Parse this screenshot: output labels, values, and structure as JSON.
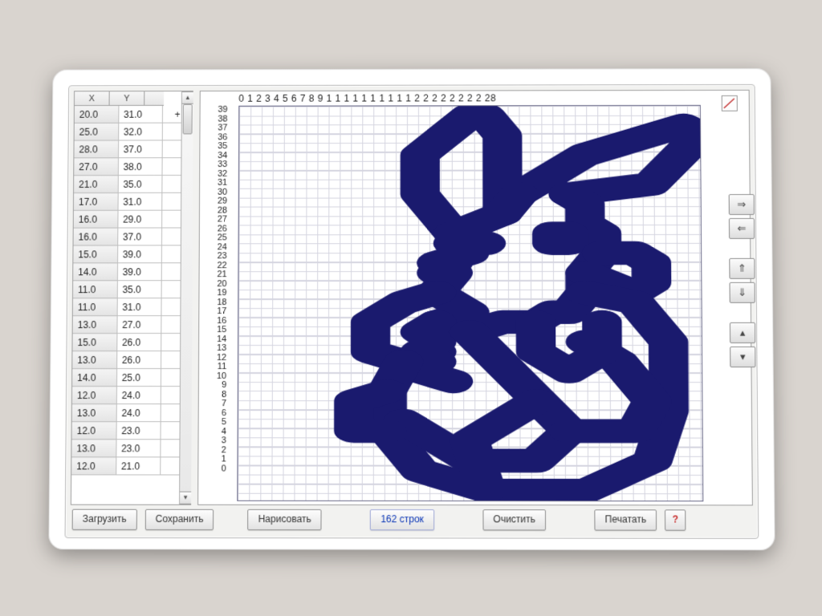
{
  "table": {
    "headers": {
      "x": "X",
      "y": "Y"
    },
    "rows": [
      {
        "x": "20.0",
        "y": "31.0",
        "m": "+"
      },
      {
        "x": "25.0",
        "y": "32.0",
        "m": ""
      },
      {
        "x": "28.0",
        "y": "37.0",
        "m": ""
      },
      {
        "x": "27.0",
        "y": "38.0",
        "m": ""
      },
      {
        "x": "21.0",
        "y": "35.0",
        "m": ""
      },
      {
        "x": "17.0",
        "y": "31.0",
        "m": ""
      },
      {
        "x": "16.0",
        "y": "29.0",
        "m": ""
      },
      {
        "x": "16.0",
        "y": "37.0",
        "m": ""
      },
      {
        "x": "15.0",
        "y": "39.0",
        "m": ""
      },
      {
        "x": "14.0",
        "y": "39.0",
        "m": ""
      },
      {
        "x": "11.0",
        "y": "35.0",
        "m": ""
      },
      {
        "x": "11.0",
        "y": "31.0",
        "m": ""
      },
      {
        "x": "13.0",
        "y": "27.0",
        "m": ""
      },
      {
        "x": "15.0",
        "y": "26.0",
        "m": ""
      },
      {
        "x": "13.0",
        "y": "26.0",
        "m": ""
      },
      {
        "x": "14.0",
        "y": "25.0",
        "m": ""
      },
      {
        "x": "12.0",
        "y": "24.0",
        "m": ""
      },
      {
        "x": "13.0",
        "y": "24.0",
        "m": ""
      },
      {
        "x": "12.0",
        "y": "23.0",
        "m": ""
      },
      {
        "x": "13.0",
        "y": "23.0",
        "m": ""
      },
      {
        "x": "12.0",
        "y": "21.0",
        "m": ""
      }
    ]
  },
  "axis": {
    "top": "0 1 2 3 4 5 6 7 8 9 1 1 1 1 1 1 1 1 1 1 2 2 2 2 2 2 2 2 28",
    "left": [
      "39",
      "38",
      "37",
      "36",
      "35",
      "34",
      "33",
      "32",
      "31",
      "30",
      "29",
      "28",
      "27",
      "26",
      "25",
      "24",
      "23",
      "22",
      "21",
      "20",
      "19",
      "18",
      "17",
      "16",
      "15",
      "14",
      "13",
      "12",
      "11",
      "10",
      "9",
      "8",
      "7",
      "6",
      "5",
      "4",
      "3",
      "2",
      "1",
      "0"
    ]
  },
  "buttons": {
    "load": "Загрузить",
    "save": "Сохранить",
    "draw": "Нарисовать",
    "count": "162 строк",
    "clear": "Очистить",
    "print": "Печатать",
    "help": "?"
  }
}
